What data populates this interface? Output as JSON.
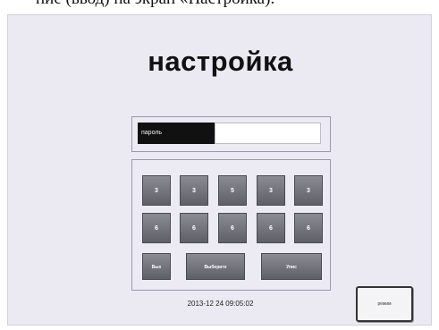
{
  "caption": "ние (ввод) на экран «Настройка).",
  "title": "настройка",
  "password": {
    "label": "пароль",
    "value": ""
  },
  "keypad": {
    "row1": [
      "3",
      "3",
      "5",
      "3",
      "3"
    ],
    "row2": [
      "6",
      "6",
      "6",
      "6",
      "6"
    ],
    "row3": [
      "Вых",
      "Выберите",
      "Упис"
    ]
  },
  "datetime": "2013-12 24 09:05:02",
  "mode_button": "режим"
}
